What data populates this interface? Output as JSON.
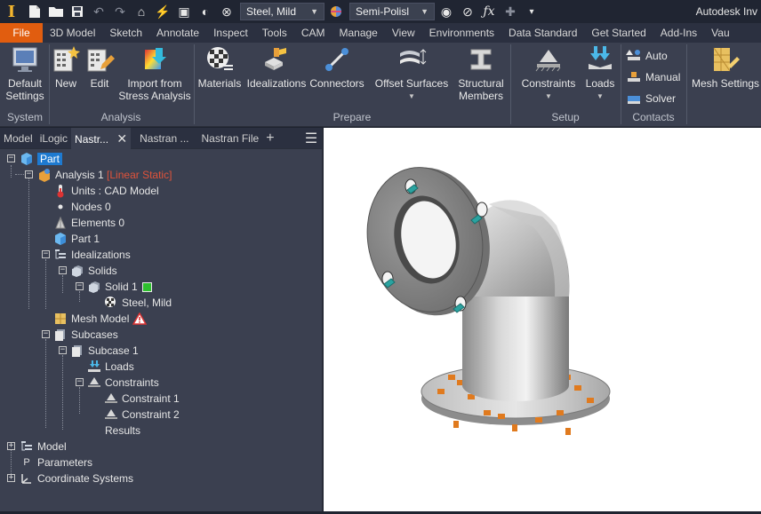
{
  "app": {
    "title": "Autodesk Inv"
  },
  "qat": {
    "material": "Steel, Mild",
    "appearance": "Semi-Polisl"
  },
  "tabs": [
    "File",
    "3D Model",
    "Sketch",
    "Annotate",
    "Inspect",
    "Tools",
    "CAM",
    "Manage",
    "View",
    "Environments",
    "Data Standard",
    "Get Started",
    "Add-Ins",
    "Vau"
  ],
  "ribbon": {
    "buttons": {
      "default_settings_1": "Default",
      "default_settings_2": "Settings",
      "new": "New",
      "edit": "Edit",
      "import_1": "Import from",
      "import_2": "Stress Analysis",
      "materials": "Materials",
      "idealizations": "Idealizations",
      "connectors": "Connectors",
      "offset_surfaces": "Offset Surfaces",
      "structural_1": "Structural",
      "structural_2": "Members",
      "constraints": "Constraints",
      "loads": "Loads",
      "auto": "Auto",
      "manual": "Manual",
      "solver": "Solver",
      "mesh_settings": "Mesh Settings"
    },
    "groups": {
      "system": "System",
      "analysis": "Analysis",
      "prepare": "Prepare",
      "setup": "Setup",
      "contacts": "Contacts"
    }
  },
  "browser": {
    "tabs": [
      "Model",
      "iLogic",
      "Nastr...",
      "Nastran ...",
      "Nastran File"
    ],
    "tree": {
      "part": "Part",
      "analysis": "Analysis 1",
      "analysis_type": "[Linear Static]",
      "units": "Units : CAD Model",
      "nodes": "Nodes 0",
      "elements": "Elements 0",
      "part1": "Part 1",
      "idealizations": "Idealizations",
      "solids": "Solids",
      "solid1": "Solid 1",
      "material": "Steel, Mild",
      "mesh_model": "Mesh Model",
      "subcases": "Subcases",
      "subcase1": "Subcase 1",
      "loads": "Loads",
      "constraints": "Constraints",
      "constraint1": "Constraint 1",
      "constraint2": "Constraint 2",
      "results": "Results",
      "model": "Model",
      "parameters": "Parameters",
      "coordinate_systems": "Coordinate Systems"
    }
  },
  "colors": {
    "file_tab": "#e15d0f",
    "selection": "#1e7ad0",
    "analysis_type": "#e0533a",
    "solid_status": "#2ec02e"
  }
}
